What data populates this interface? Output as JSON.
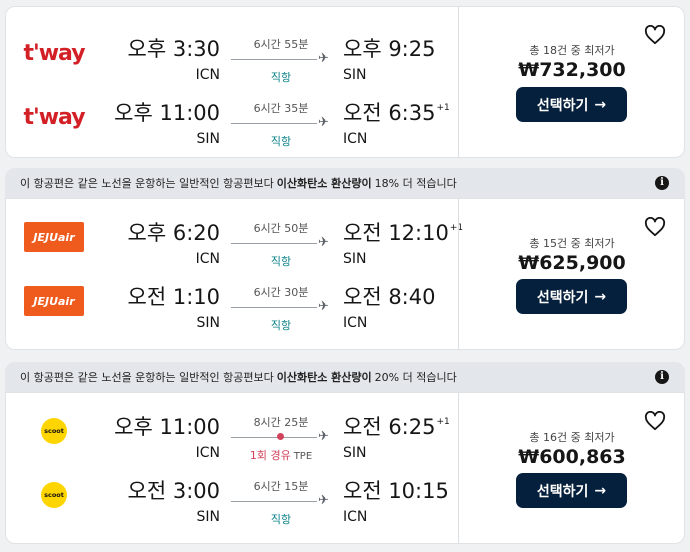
{
  "results": [
    {
      "banner": null,
      "legs": [
        {
          "logo": "t'way",
          "logo_style": "tway",
          "dep_time": "오후 3:30",
          "dep_code": "ICN",
          "duration": "6시간 55분",
          "stops": "직항",
          "stop_via": "",
          "arr_time": "오후 9:25",
          "arr_plus": "",
          "arr_code": "SIN"
        },
        {
          "logo": "t'way",
          "logo_style": "tway",
          "dep_time": "오후 11:00",
          "dep_code": "SIN",
          "duration": "6시간 35분",
          "stops": "직항",
          "stop_via": "",
          "arr_time": "오전 6:35",
          "arr_plus": "+1",
          "arr_code": "ICN"
        }
      ],
      "deals_text": "총 18건 중 최저가",
      "price": "₩732,300",
      "select_label": "선택하기",
      "favorite_icon": "heart-outline-icon"
    },
    {
      "banner": {
        "pre": "이 항공편은 같은 노선을 운항하는 일반적인 항공편보다",
        "bold": "이산화탄소 환산량이",
        "post": "18% 더 적습니다",
        "icon": "info-icon"
      },
      "legs": [
        {
          "logo": "JEJUair",
          "logo_style": "jeju",
          "dep_time": "오후 6:20",
          "dep_code": "ICN",
          "duration": "6시간 50분",
          "stops": "직항",
          "stop_via": "",
          "arr_time": "오전 12:10",
          "arr_plus": "+1",
          "arr_code": "SIN"
        },
        {
          "logo": "JEJUair",
          "logo_style": "jeju",
          "dep_time": "오전 1:10",
          "dep_code": "SIN",
          "duration": "6시간 30분",
          "stops": "직항",
          "stop_via": "",
          "arr_time": "오전 8:40",
          "arr_plus": "",
          "arr_code": "ICN"
        }
      ],
      "deals_text": "총 15건 중 최저가",
      "price": "₩625,900",
      "select_label": "선택하기",
      "favorite_icon": "heart-outline-icon"
    },
    {
      "banner": {
        "pre": "이 항공편은 같은 노선을 운항하는 일반적인 항공편보다",
        "bold": "이산화탄소 환산량이",
        "post": "20% 더 적습니다",
        "icon": "info-icon"
      },
      "legs": [
        {
          "logo": "scoot",
          "logo_style": "scoot",
          "dep_time": "오후 11:00",
          "dep_code": "ICN",
          "duration": "8시간 25분",
          "stops": "1회 경유",
          "stop_via": "TPE",
          "arr_time": "오전 6:25",
          "arr_plus": "+1",
          "arr_code": "SIN"
        },
        {
          "logo": "scoot",
          "logo_style": "scoot",
          "dep_time": "오전 3:00",
          "dep_code": "SIN",
          "duration": "6시간 15분",
          "stops": "직항",
          "stop_via": "",
          "arr_time": "오전 10:15",
          "arr_plus": "",
          "arr_code": "ICN"
        }
      ],
      "deals_text": "총 16건 중 최저가",
      "price": "₩600,863",
      "select_label": "선택하기",
      "favorite_icon": "heart-outline-icon"
    }
  ],
  "colors": {
    "button": "#05203c",
    "direct": "#0c838a",
    "stopover": "#d1435b",
    "tway": "#d31f26",
    "jeju": "#ef5a1d",
    "scoot": "#ffd500"
  }
}
